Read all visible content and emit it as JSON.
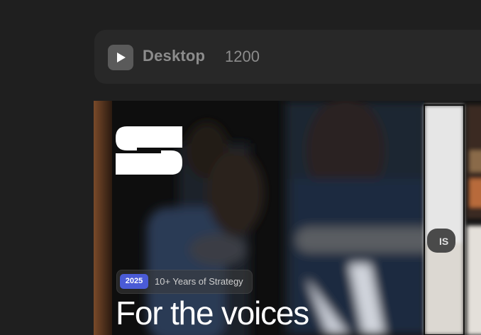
{
  "toolbar": {
    "breakpoint_name": "Desktop",
    "breakpoint_width": "1200",
    "play_icon": "play-icon"
  },
  "hero": {
    "logo": "S",
    "badge_year": "2025",
    "badge_text": "10+ Years of Strategy",
    "title": "For the voices"
  },
  "colors": {
    "background": "#1f1f1f",
    "toolbar": "#282828",
    "badge": "#4a5bd6"
  }
}
